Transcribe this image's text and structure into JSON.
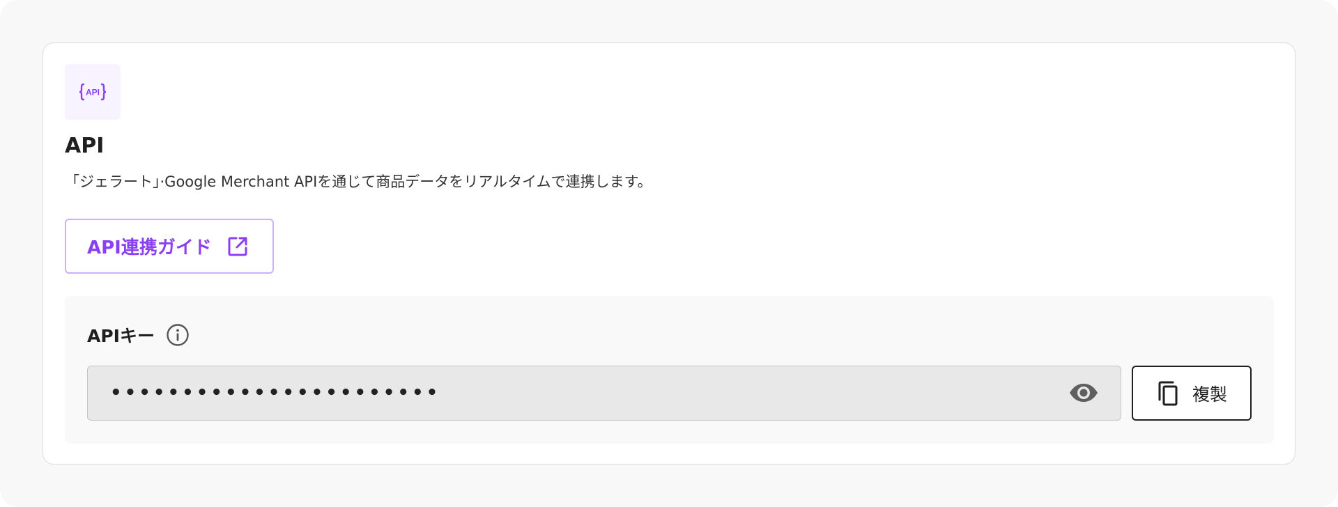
{
  "card": {
    "icon": "api-icon",
    "title": "API",
    "description": "「ジェラート」·Google Merchant APIを通じて商品データをリアルタイムで連携します。"
  },
  "guide_button": {
    "label": "API連携ガイド",
    "icon": "external-link-icon"
  },
  "api_key": {
    "label": "APIキー",
    "info_icon": "info-icon",
    "value": "•••••••••••••••••••••••",
    "visibility_icon": "eye-icon",
    "copy_label": "複製",
    "copy_icon": "copy-icon"
  },
  "colors": {
    "accent": "#8b3ff0",
    "accent_border": "#cdb0fb",
    "icon_tile_bg": "#f7f3ff",
    "field_bg": "#e8e8e8",
    "panel_bg": "#f9f9f9"
  }
}
